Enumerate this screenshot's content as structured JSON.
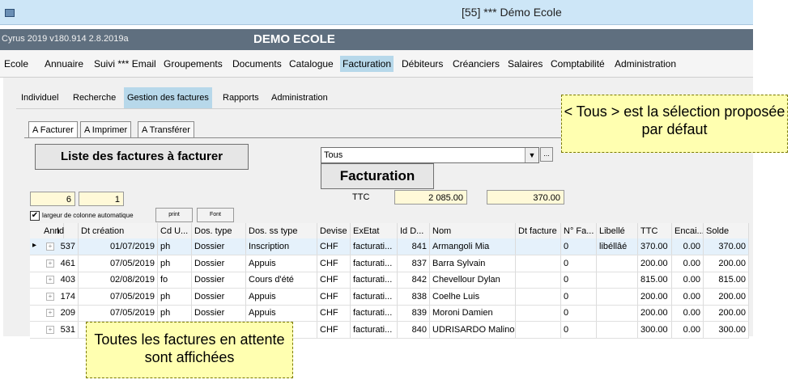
{
  "window": {
    "title": "[55] *** Démo Ecole"
  },
  "app": {
    "version": "Cyrus 2019 v180.914 2.8.2019a",
    "school": "DEMO ECOLE"
  },
  "menu": [
    "Ecole",
    "Annuaire",
    "Suivi *** Email",
    "Groupements",
    "Documents",
    "Catalogue",
    "Facturation",
    "Débiteurs",
    "Créanciers",
    "Salaires",
    "Comptabilité",
    "Administration"
  ],
  "subtabs": [
    "Individuel",
    "Recherche",
    "Gestion des factures",
    "Rapports",
    "Administration"
  ],
  "innertabs": [
    "A Facturer",
    "A Imprimer",
    "A Transférer"
  ],
  "buttons": {
    "list": "Liste des factures à facturer",
    "facturation": "Facturation",
    "print": "print",
    "font": "Font",
    "ellipsis": "..."
  },
  "selection": {
    "value": "Tous",
    "dropdown_icon": "▼"
  },
  "counters": {
    "count1": "6",
    "count2": "1",
    "ttc_label": "TTC",
    "ttc_value": "2 085.00",
    "solde_value": "370.00"
  },
  "autowidth": {
    "checked": "✔",
    "label": "largeur de colonne automatique"
  },
  "grid": {
    "headers": [
      "Ann",
      "Id",
      "Dt création",
      "Cd U...",
      "Dos. type",
      "Dos. ss type",
      "Devise",
      "ExEtat",
      "Id D...",
      "Nom",
      "Dt facture",
      "N° Fa...",
      "Libellé",
      "TTC",
      "Encai...",
      "Solde"
    ],
    "rows": [
      {
        "ann": "",
        "id": "537",
        "dt": "01/07/2019",
        "cd": "ph",
        "type": "Dossier",
        "sstype": "Inscription",
        "devise": "CHF",
        "exetat": "facturati...",
        "idd": "841",
        "nom": "Armangoli Mia",
        "dtf": "",
        "nfa": "0",
        "lib": "libéllâé",
        "ttc": "370.00",
        "enc": "0.00",
        "solde": "370.00"
      },
      {
        "ann": "",
        "id": "461",
        "dt": "07/05/2019",
        "cd": "ph",
        "type": "Dossier",
        "sstype": "Appuis",
        "devise": "CHF",
        "exetat": "facturati...",
        "idd": "837",
        "nom": "Barra Sylvain",
        "dtf": "",
        "nfa": "0",
        "lib": "",
        "ttc": "200.00",
        "enc": "0.00",
        "solde": "200.00"
      },
      {
        "ann": "",
        "id": "403",
        "dt": "02/08/2019",
        "cd": "fo",
        "type": "Dossier",
        "sstype": "Cours d'été",
        "devise": "CHF",
        "exetat": "facturati...",
        "idd": "842",
        "nom": "Chevellour Dylan",
        "dtf": "",
        "nfa": "0",
        "lib": "",
        "ttc": "815.00",
        "enc": "0.00",
        "solde": "815.00"
      },
      {
        "ann": "",
        "id": "174",
        "dt": "07/05/2019",
        "cd": "ph",
        "type": "Dossier",
        "sstype": "Appuis",
        "devise": "CHF",
        "exetat": "facturati...",
        "idd": "838",
        "nom": "Coelhe Luis",
        "dtf": "",
        "nfa": "0",
        "lib": "",
        "ttc": "200.00",
        "enc": "0.00",
        "solde": "200.00"
      },
      {
        "ann": "",
        "id": "209",
        "dt": "07/05/2019",
        "cd": "ph",
        "type": "Dossier",
        "sstype": "Appuis",
        "devise": "CHF",
        "exetat": "facturati...",
        "idd": "839",
        "nom": "Moroni Damien",
        "dtf": "",
        "nfa": "0",
        "lib": "",
        "ttc": "200.00",
        "enc": "0.00",
        "solde": "200.00"
      },
      {
        "ann": "",
        "id": "531",
        "dt": "",
        "cd": "",
        "type": "",
        "sstype": "",
        "devise": "CHF",
        "exetat": "facturati...",
        "idd": "840",
        "nom": "UDRISARDO Malino",
        "dtf": "",
        "nfa": "0",
        "lib": "",
        "ttc": "300.00",
        "enc": "0.00",
        "solde": "300.00"
      }
    ]
  },
  "callouts": {
    "top": "< Tous > est la sélection proposée par défaut",
    "bottom": "Toutes les factures en attente sont affichées"
  }
}
